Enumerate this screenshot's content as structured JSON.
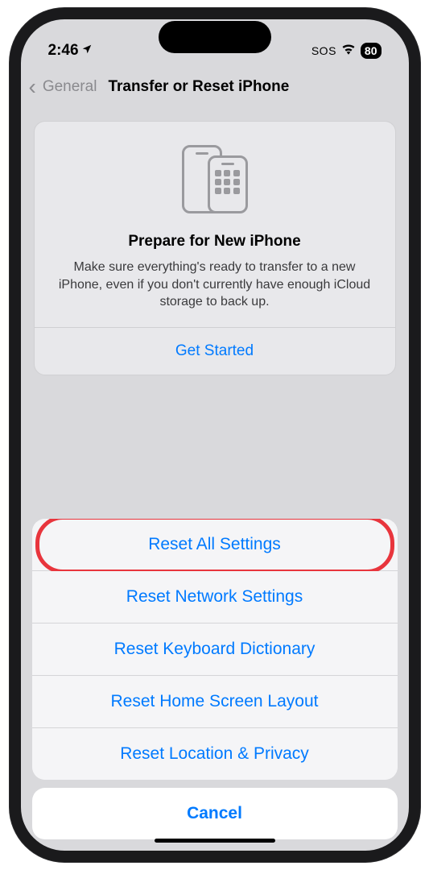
{
  "status": {
    "time": "2:46",
    "sos": "SOS",
    "battery": "80"
  },
  "nav": {
    "back_label": "General",
    "title": "Transfer or Reset iPhone"
  },
  "prepare": {
    "title": "Prepare for New iPhone",
    "description": "Make sure everything's ready to transfer to a new iPhone, even if you don't currently have enough iCloud storage to back up.",
    "cta": "Get Started"
  },
  "sheet": {
    "options": [
      "Reset All Settings",
      "Reset Network Settings",
      "Reset Keyboard Dictionary",
      "Reset Home Screen Layout",
      "Reset Location & Privacy"
    ],
    "cancel": "Cancel"
  }
}
